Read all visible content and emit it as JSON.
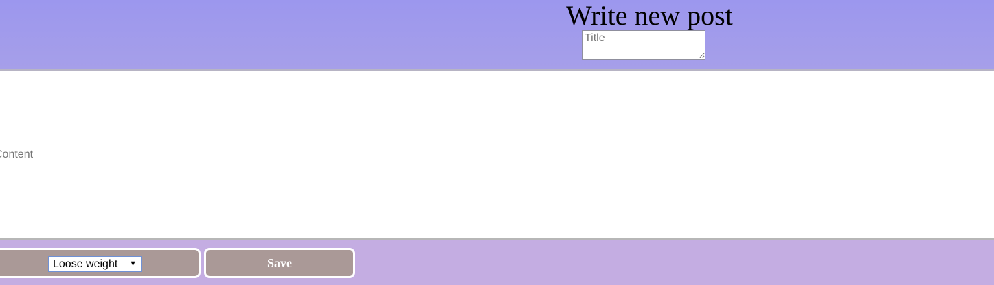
{
  "header": {
    "title": "Write new post",
    "title_placeholder": "Title"
  },
  "editor": {
    "content_placeholder": "Content"
  },
  "footer": {
    "category": {
      "selected": "Loose weight"
    },
    "save_label": "Save"
  },
  "colors": {
    "header_background": "#9c97ee",
    "footer_background": "#c4ade2",
    "button_background": "#aa9997",
    "button_text": "#ffffff"
  }
}
